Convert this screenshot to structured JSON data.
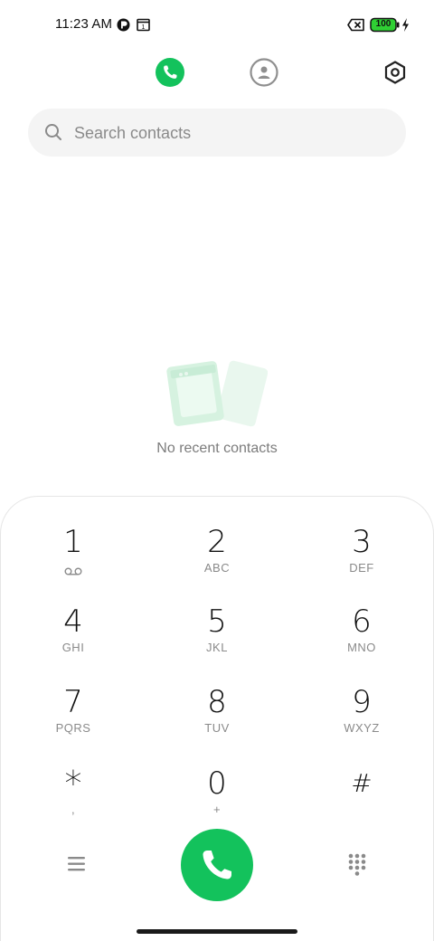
{
  "status_bar": {
    "time": "11:23 AM",
    "battery_level": "100",
    "icons": [
      "pinwheel-icon",
      "calendar-icon",
      "sim-off-icon",
      "battery-icon",
      "charging-icon"
    ]
  },
  "top_nav": {
    "items": [
      {
        "name": "phone-tab",
        "icon": "phone-icon",
        "active": true
      },
      {
        "name": "contacts-tab",
        "icon": "person-icon",
        "active": false
      },
      {
        "name": "settings",
        "icon": "gear-icon",
        "active": false
      }
    ]
  },
  "search": {
    "placeholder": "Search contacts"
  },
  "empty_state": {
    "message": "No recent contacts"
  },
  "dialpad": {
    "keys": [
      {
        "digit": "1",
        "letters": ""
      },
      {
        "digit": "2",
        "letters": "ABC"
      },
      {
        "digit": "3",
        "letters": "DEF"
      },
      {
        "digit": "4",
        "letters": "GHI"
      },
      {
        "digit": "5",
        "letters": "JKL"
      },
      {
        "digit": "6",
        "letters": "MNO"
      },
      {
        "digit": "7",
        "letters": "PQRS"
      },
      {
        "digit": "8",
        "letters": "TUV"
      },
      {
        "digit": "9",
        "letters": "WXYZ"
      },
      {
        "digit": "*",
        "letters": ","
      },
      {
        "digit": "0",
        "letters": "+"
      },
      {
        "digit": "#",
        "letters": ""
      }
    ]
  },
  "colors": {
    "accent_green": "#13c25c",
    "muted_text": "#8a8a8a"
  }
}
